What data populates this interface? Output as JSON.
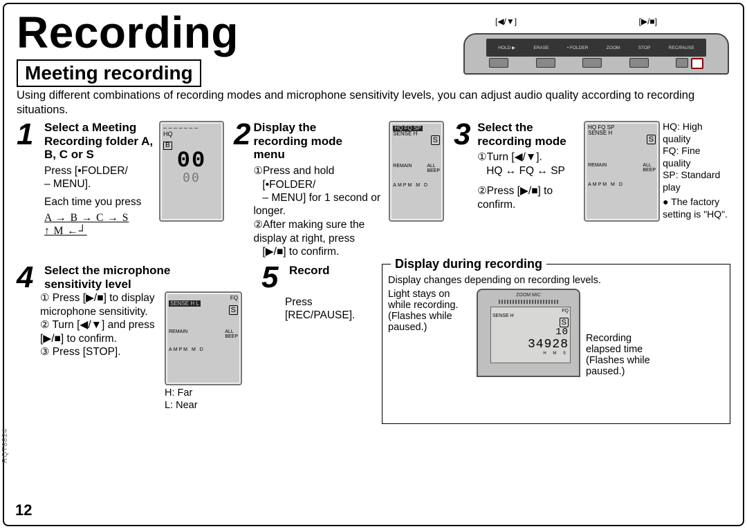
{
  "title": "Recording",
  "section": "Meeting recording",
  "intro": "Using different combinations of recording modes and microphone sensitivity levels, you can adjust audio quality according to recording situations.",
  "sideways_code": "RQT8824",
  "page_number": "12",
  "device_top": {
    "labels": [
      "HOLD ▶",
      "ERASE",
      "• FOLDER",
      "ZOOM",
      "STOP",
      "REC/PAUSE"
    ],
    "arrow_label_left": "[◀/▼]",
    "arrow_label_right": "[▶/■]"
  },
  "step1": {
    "num": "1",
    "head": "Select a Meeting Recording folder A, B, C or S",
    "line1": "Press [•FOLDER/",
    "line2": "– MENU].",
    "line3": "Each time you press",
    "cycle": "A → B → C → S",
    "cycle2": "↑        M ←┘",
    "lcd": {
      "top": "HQ",
      "folder": "B",
      "dashes": "– – – – – – –",
      "big1": "00",
      "big2": "00"
    }
  },
  "step2": {
    "num": "2",
    "head": "Display the recording mode menu",
    "l1": "Press and hold",
    "l2": "[•FOLDER/",
    "l3": "– MENU] for 1 second or longer.",
    "l4": "After making sure the display at right, press",
    "l5": "[▶/■] to confirm.",
    "lcd": {
      "top": "HQ FQ SP",
      "sense": "SENSE H",
      "folder": "S",
      "mid": "REMAIN",
      "right": "ALL\nBEEP",
      "bottom": "AMPM   M   D"
    }
  },
  "step3": {
    "num": "3",
    "head": "Select the recording mode",
    "l1": "Turn [◀/▼].",
    "l2": "HQ ↔ FQ ↔ SP",
    "l3": "Press [▶/■] to confirm.",
    "lcd": {
      "top": "HQ FQ SP",
      "sense": "SENSE H",
      "folder": "S",
      "mid": "REMAIN",
      "right": "ALL\nBEEP",
      "bottom": "AMPM   M   D"
    },
    "notes": {
      "hq": "HQ: High quality",
      "fq": "FQ: Fine quality",
      "sp": "SP: Standard play",
      "factory": "● The factory setting is \"HQ\"."
    }
  },
  "step4": {
    "num": "4",
    "head": "Select the microphone sensitivity level",
    "l1": "Press [▶/■] to display microphone sensitivity.",
    "l2": "Turn [◀/▼] and press [▶/■] to confirm.",
    "l3": "Press [STOP].",
    "l4": "H: Far",
    "l5": "L: Near",
    "lcd": {
      "top": "FQ",
      "sense": "SENSE H L",
      "folder": "S",
      "mid": "REMAIN",
      "right": "ALL\nBEEP",
      "bottom": "AMPM   M   D"
    }
  },
  "step5": {
    "num": "5",
    "head": "Record",
    "l1": "Press [REC/PAUSE]."
  },
  "display_during": {
    "title": "Display during recording",
    "sub": "Display changes depending on recording levels.",
    "light": "Light stays on while recording. (Flashes while paused.)",
    "elapsed": "Recording elapsed time (Flashes while paused.)",
    "screen": {
      "top": "FQ",
      "sense": "SENSE H",
      "folder": "S",
      "count": "10",
      "time": "34928",
      "hms": "H   M   S",
      "zoom": "ZOOM MIC"
    }
  }
}
